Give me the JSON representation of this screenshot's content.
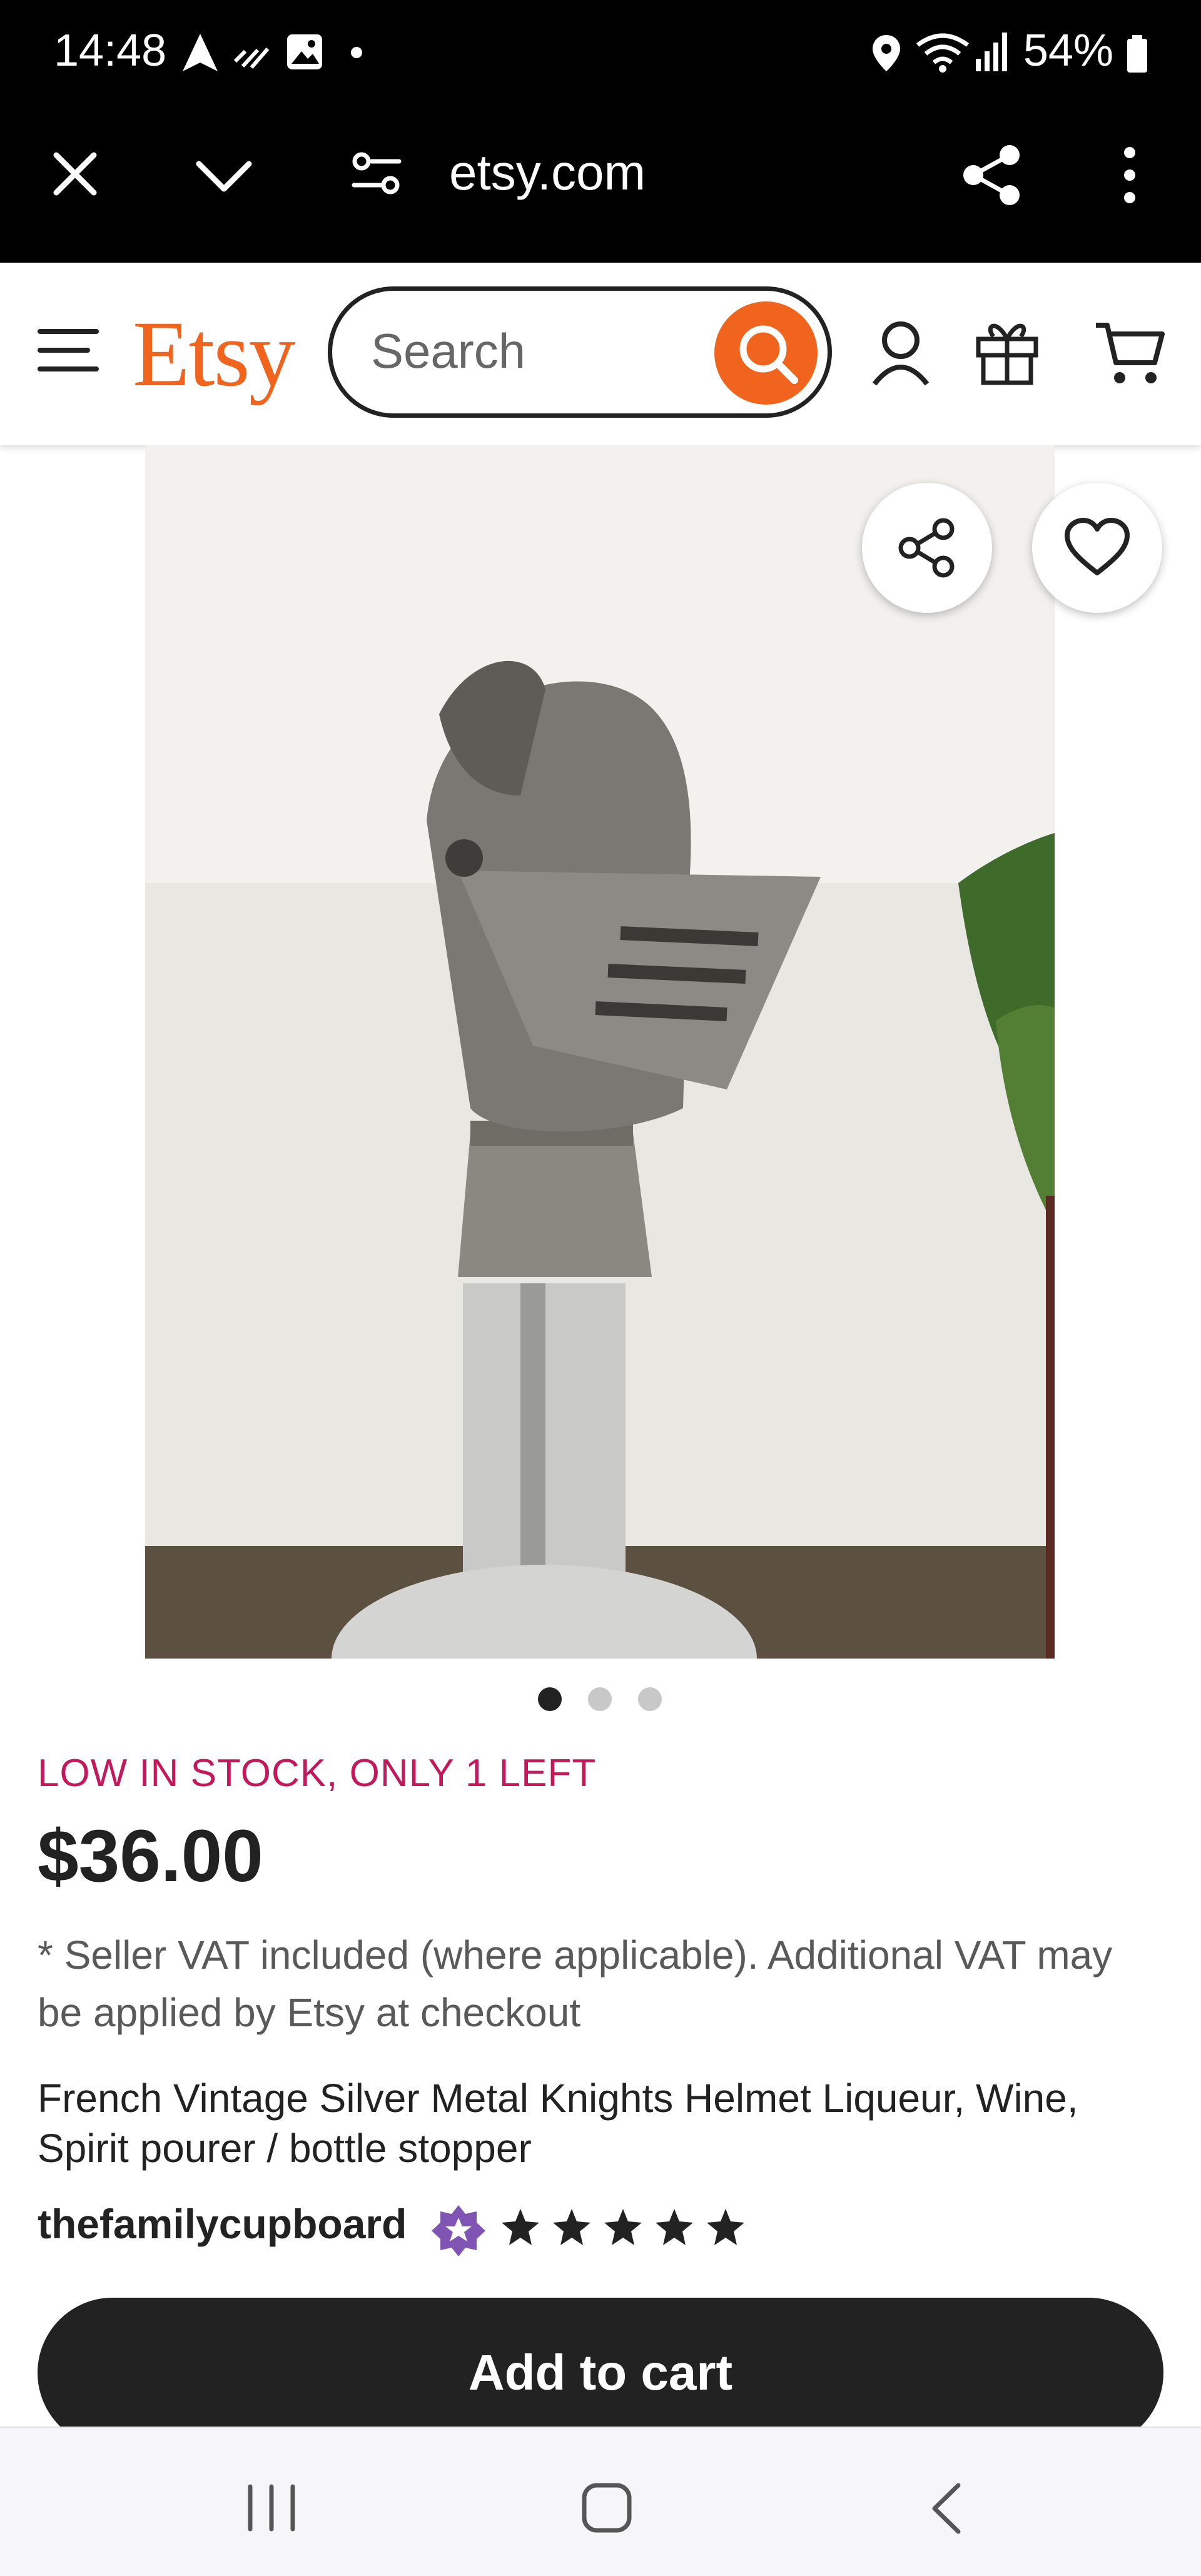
{
  "status_bar": {
    "time": "14:48",
    "battery": "54%",
    "icons": [
      "navigation-icon",
      "missed-call-icon",
      "gallery-icon",
      "dot-icon",
      "location-icon",
      "wifi-icon",
      "signal-icon",
      "battery-icon"
    ]
  },
  "browser": {
    "url": "etsy.com",
    "icons": [
      "close-icon",
      "chevron-down-icon",
      "site-settings-icon",
      "share-icon",
      "more-icon"
    ]
  },
  "header": {
    "logo": "Etsy",
    "search_placeholder": "Search",
    "brand_color": "#f1641e",
    "icons": [
      "menu-icon",
      "search-icon",
      "account-icon",
      "gift-icon",
      "cart-icon"
    ]
  },
  "gallery": {
    "image_index": 1,
    "image_count": 3,
    "buttons": [
      "share-icon",
      "heart-icon"
    ]
  },
  "product": {
    "stock_notice": "LOW IN STOCK, ONLY 1 LEFT",
    "price": "$36.00",
    "vat_note": "* Seller VAT included (where applicable). Additional VAT may be applied by Etsy at checkout",
    "title": "French Vintage Silver Metal Knights Helmet Liqueur, Wine, Spirit pourer / bottle stopper",
    "seller": "thefamilycupboard",
    "rating": 5,
    "rating_max": 5,
    "stock_color": "#c3185b"
  },
  "actions": {
    "add_to_cart": "Add to cart"
  },
  "system_nav": {
    "icons": [
      "recents-icon",
      "home-icon",
      "back-icon"
    ]
  }
}
